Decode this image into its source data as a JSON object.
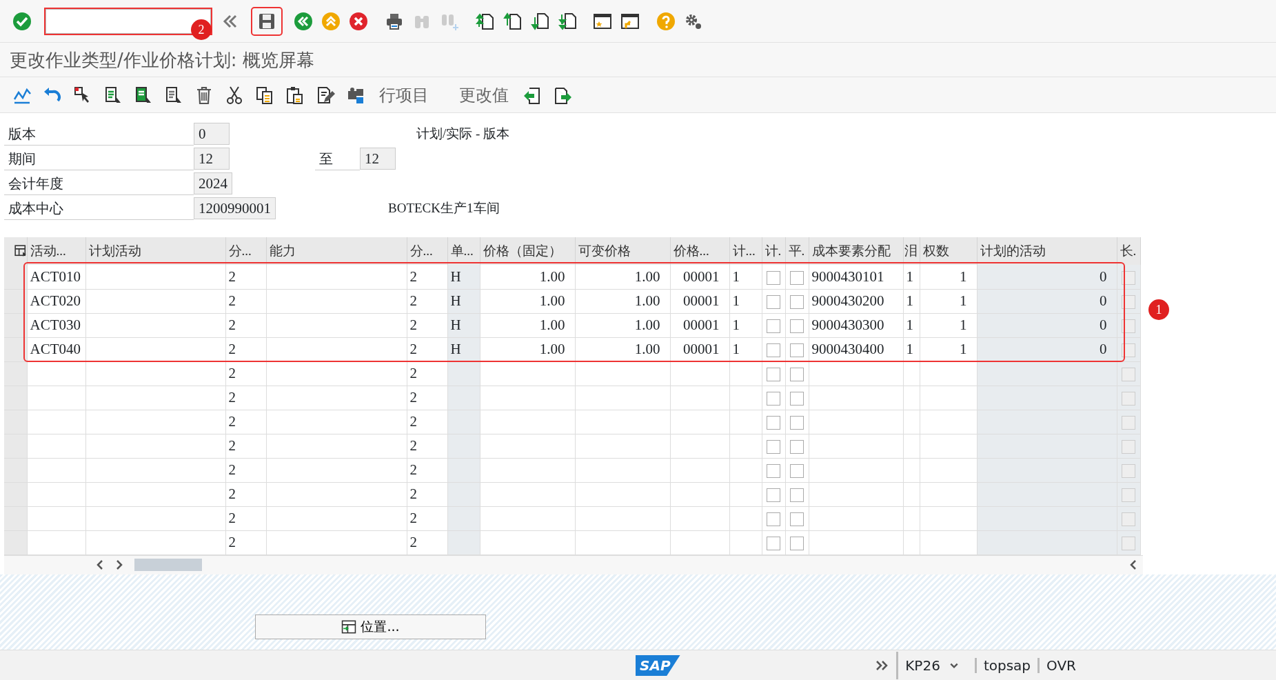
{
  "title": "更改作业类型/作业价格计划: 概览屏幕",
  "app_toolbar": {
    "buttons": [
      {
        "label": "行项目"
      },
      {
        "label": "更改值"
      }
    ]
  },
  "header_fields": [
    {
      "label": "版本",
      "value": "0",
      "description": "计划/实际 - 版本"
    },
    {
      "label": "期间",
      "value": "12",
      "to_label": "至",
      "to_value": "12"
    },
    {
      "label": "会计年度",
      "value": "2024"
    },
    {
      "label": "成本中心",
      "value": "1200990001",
      "description": "BOTECK生产1车间"
    }
  ],
  "table": {
    "columns": [
      {
        "label": "活动...",
        "kind": "text",
        "readonly": false
      },
      {
        "label": "计划活动",
        "kind": "text",
        "readonly": false
      },
      {
        "label": "分...",
        "kind": "text",
        "readonly": false
      },
      {
        "label": "能力",
        "kind": "text",
        "readonly": false
      },
      {
        "label": "分...",
        "kind": "text",
        "readonly": false
      },
      {
        "label": "单...",
        "kind": "text",
        "readonly": true
      },
      {
        "label": "价格（固定）",
        "kind": "number",
        "readonly": false
      },
      {
        "label": "可变价格",
        "kind": "number",
        "readonly": false
      },
      {
        "label": "价格...",
        "kind": "number",
        "readonly": false
      },
      {
        "label": "计...",
        "kind": "text",
        "readonly": false
      },
      {
        "label": "计.",
        "kind": "checkbox",
        "readonly": false
      },
      {
        "label": "平.",
        "kind": "checkbox",
        "readonly": false
      },
      {
        "label": "成本要素分配",
        "kind": "text",
        "readonly": false
      },
      {
        "label": "泪",
        "kind": "text",
        "readonly": false
      },
      {
        "label": "权数",
        "kind": "number",
        "readonly": false
      },
      {
        "label": "计划的活动",
        "kind": "number",
        "readonly": true
      },
      {
        "label": "长.",
        "kind": "checkbox",
        "readonly": true
      }
    ],
    "rows": [
      {
        "cells": [
          "ACT010",
          null,
          "2",
          null,
          "2",
          "H",
          "1.00",
          "1.00",
          "00001",
          "1",
          false,
          false,
          "9000430101",
          "1",
          "1",
          "0",
          false
        ]
      },
      {
        "cells": [
          "ACT020",
          null,
          "2",
          null,
          "2",
          "H",
          "1.00",
          "1.00",
          "00001",
          "1",
          false,
          false,
          "9000430200",
          "1",
          "1",
          "0",
          false
        ]
      },
      {
        "cells": [
          "ACT030",
          null,
          "2",
          null,
          "2",
          "H",
          "1.00",
          "1.00",
          "00001",
          "1",
          false,
          false,
          "9000430300",
          "1",
          "1",
          "0",
          false
        ]
      },
      {
        "cells": [
          "ACT040",
          null,
          "2",
          null,
          "2",
          "H",
          "1.00",
          "1.00",
          "00001",
          "1",
          false,
          false,
          "9000430400",
          "1",
          "1",
          "0",
          false
        ]
      },
      {
        "cells": [
          null,
          null,
          "2",
          null,
          "2",
          null,
          null,
          null,
          null,
          null,
          false,
          false,
          null,
          null,
          null,
          null,
          false
        ]
      },
      {
        "cells": [
          null,
          null,
          "2",
          null,
          "2",
          null,
          null,
          null,
          null,
          null,
          false,
          false,
          null,
          null,
          null,
          null,
          false
        ]
      },
      {
        "cells": [
          null,
          null,
          "2",
          null,
          "2",
          null,
          null,
          null,
          null,
          null,
          false,
          false,
          null,
          null,
          null,
          null,
          false
        ]
      },
      {
        "cells": [
          null,
          null,
          "2",
          null,
          "2",
          null,
          null,
          null,
          null,
          null,
          false,
          false,
          null,
          null,
          null,
          null,
          false
        ]
      },
      {
        "cells": [
          null,
          null,
          "2",
          null,
          "2",
          null,
          null,
          null,
          null,
          null,
          false,
          false,
          null,
          null,
          null,
          null,
          false
        ]
      },
      {
        "cells": [
          null,
          null,
          "2",
          null,
          "2",
          null,
          null,
          null,
          null,
          null,
          false,
          false,
          null,
          null,
          null,
          null,
          false
        ]
      },
      {
        "cells": [
          null,
          null,
          "2",
          null,
          "2",
          null,
          null,
          null,
          null,
          null,
          false,
          false,
          null,
          null,
          null,
          null,
          false
        ]
      },
      {
        "cells": [
          null,
          null,
          "2",
          null,
          "2",
          null,
          null,
          null,
          null,
          null,
          false,
          false,
          null,
          null,
          null,
          null,
          false
        ]
      }
    ]
  },
  "position_button": {
    "label": "位置..."
  },
  "annotations": [
    {
      "label": "1"
    },
    {
      "label": "2"
    }
  ],
  "status_bar": {
    "logo": "SAP",
    "items": [
      {
        "label": "KP26",
        "kind": "dropdown"
      },
      {
        "label": "topsap",
        "kind": "text"
      },
      {
        "label": "OVR",
        "kind": "text"
      }
    ]
  }
}
